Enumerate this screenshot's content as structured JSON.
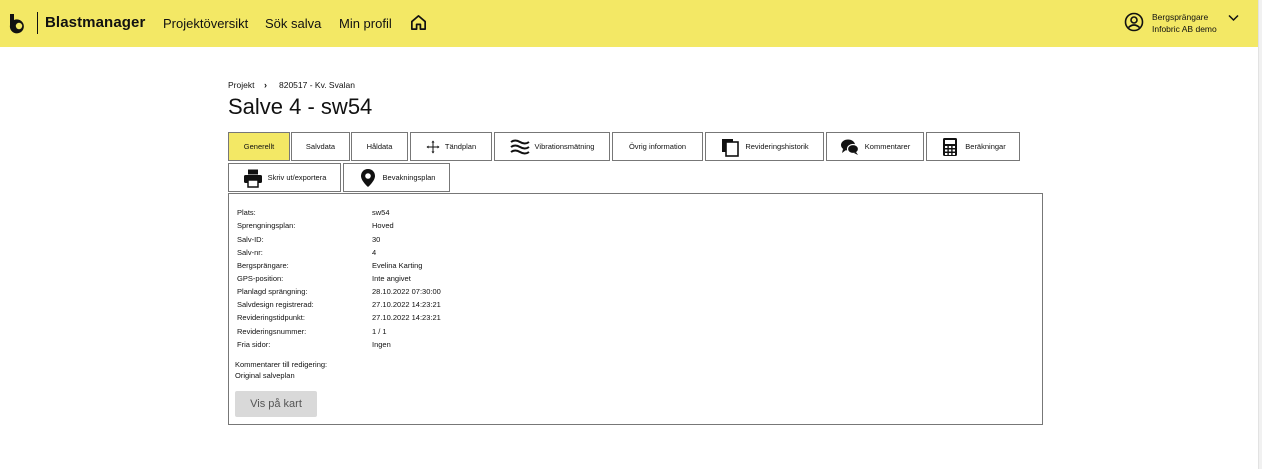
{
  "app": {
    "brand": "Blastmanager",
    "colors": {
      "topbar": "#f3e865",
      "active_tab": "#f3e865",
      "border": "#777777"
    }
  },
  "nav": {
    "items": [
      "Projektöversikt",
      "Sök salva",
      "Min profil"
    ],
    "home_icon": "home-icon"
  },
  "user": {
    "name": "Bergsprängare",
    "org": "Infobric AB demo"
  },
  "breadcrumb": {
    "root": "Projekt",
    "separator": "›",
    "project": "820517 - Kv. Svalan"
  },
  "page": {
    "title": "Salve 4 - sw54"
  },
  "tabs": [
    {
      "label": "Generellt",
      "icon": "",
      "active": true
    },
    {
      "label": "Salvdata",
      "icon": ""
    },
    {
      "label": "Håldata",
      "icon": ""
    },
    {
      "label": "Tändplan",
      "icon": "move-arrows-icon"
    },
    {
      "label": "Vibrationsmätning",
      "icon": "waves-icon"
    },
    {
      "label": "Övrig information",
      "icon": ""
    },
    {
      "label": "Revideringshistorik",
      "icon": "documents-icon"
    },
    {
      "label": "Kommentarer",
      "icon": "chat-icon"
    },
    {
      "label": "Beräkningar",
      "icon": "calculator-icon"
    },
    {
      "label": "Skriv ut/exportera",
      "icon": "printer-icon"
    },
    {
      "label": "Bevakningsplan",
      "icon": "location-pin-icon"
    }
  ],
  "details": [
    {
      "label": "Plats:",
      "value": "sw54"
    },
    {
      "label": "Sprengningsplan:",
      "value": "Hoved"
    },
    {
      "label": "Salv-ID:",
      "value": "30"
    },
    {
      "label": "Salv-nr:",
      "value": "4"
    },
    {
      "label": "Bergsprängare:",
      "value": "Evelina Karting"
    },
    {
      "label": "GPS-position:",
      "value": "Inte angivet"
    },
    {
      "label": "Planlagd sprängning:",
      "value": "28.10.2022 07:30:00"
    },
    {
      "label": "Salvdesign registrerad:",
      "value": "27.10.2022 14:23:21"
    },
    {
      "label": "Revideringstidpunkt:",
      "value": "27.10.2022 14:23:21"
    },
    {
      "label": "Revideringsnummer:",
      "value": "1 / 1"
    },
    {
      "label": "Fria sidor:",
      "value": "Ingen"
    }
  ],
  "comments": {
    "label": "Kommentarer till redigering:",
    "value": "Original salveplan"
  },
  "map_button": "Vis på kart"
}
